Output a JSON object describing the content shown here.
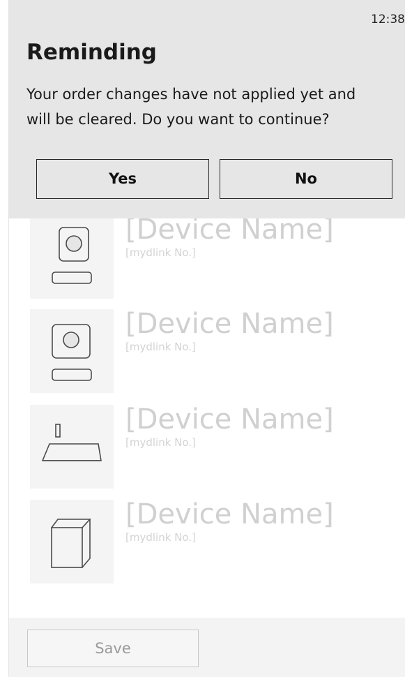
{
  "status_bar": {
    "time": "12:38"
  },
  "dialog": {
    "title": "Reminding",
    "message_line1": "Your order changes have not applied yet and",
    "message_line2": "will be cleared. Do you want to continue?",
    "yes_label": "Yes",
    "no_label": "No"
  },
  "devices": [
    {
      "name": "[Device Name]",
      "mydlink_no": "[mydlink No.]",
      "icon": "camera-icon"
    },
    {
      "name": "[Device Name]",
      "mydlink_no": "[mydlink No.]",
      "icon": "camera-icon"
    },
    {
      "name": "[Device Name]",
      "mydlink_no": "[mydlink No.]",
      "icon": "router-icon"
    },
    {
      "name": "[Device Name]",
      "mydlink_no": "[mydlink No.]",
      "icon": "box-device-icon"
    }
  ],
  "footer": {
    "save_label": "Save"
  },
  "colors": {
    "dialog_bg": "#e6e6e6",
    "placeholder_text": "#d0d0d0",
    "button_border": "#262626"
  }
}
